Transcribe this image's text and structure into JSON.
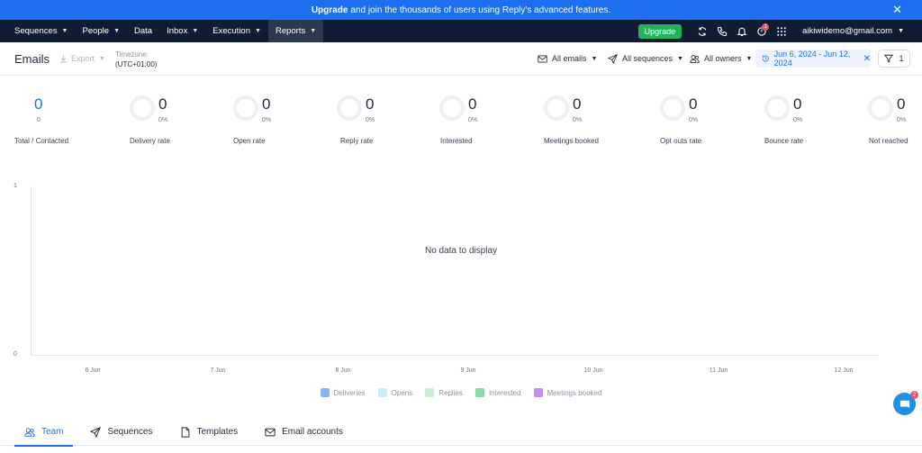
{
  "banner": {
    "strong": "Upgrade",
    "text": "and join the thousands of users using Reply's advanced features.",
    "close_glyph": "✕"
  },
  "nav": {
    "items": [
      {
        "label": "Sequences",
        "has_chevron": true
      },
      {
        "label": "People",
        "has_chevron": true
      },
      {
        "label": "Data",
        "has_chevron": false
      },
      {
        "label": "Inbox",
        "has_chevron": true
      },
      {
        "label": "Execution",
        "has_chevron": true
      },
      {
        "label": "Reports",
        "has_chevron": true,
        "active": true
      }
    ],
    "upgrade_label": "Upgrade",
    "notification_count": "1",
    "user_email": "aikiwidemo@gmail.com",
    "icons": [
      "sync-icon",
      "phone-icon",
      "bell-icon",
      "notification-icon",
      "apps-grid-icon"
    ]
  },
  "toolbar": {
    "title": "Emails",
    "export_label": "Export",
    "timezone_label": "Timezone:",
    "timezone_value": "(UTC+01:00)",
    "filters": {
      "emails": "All emails",
      "sequences": "All sequences",
      "owners": "All owners"
    },
    "date_range": "Jun 6, 2024 - Jun 12, 2024",
    "filter_count": "1"
  },
  "stats": [
    {
      "label": "Total / Contacted",
      "value": "0",
      "sub": "0",
      "ring": false
    },
    {
      "label": "Delivery rate",
      "value": "0",
      "sub": "0%",
      "ring": true
    },
    {
      "label": "Open rate",
      "value": "0",
      "sub": "0%",
      "ring": true
    },
    {
      "label": "Reply rate",
      "value": "0",
      "sub": "0%",
      "ring": true
    },
    {
      "label": "Interested",
      "value": "0",
      "sub": "0%",
      "ring": true
    },
    {
      "label": "Meetings booked",
      "value": "0",
      "sub": "0%",
      "ring": true
    },
    {
      "label": "Opt outs rate",
      "value": "0",
      "sub": "0%",
      "ring": true
    },
    {
      "label": "Bounce rate",
      "value": "0",
      "sub": "0%",
      "ring": true
    },
    {
      "label": "Not reached",
      "value": "0",
      "sub": "0%",
      "ring": true
    }
  ],
  "chart": {
    "empty_message": "No data to display",
    "y_ticks": [
      "1",
      "0"
    ],
    "x_ticks": [
      "6 Jun",
      "7 Jun",
      "8 Jun",
      "9 Jun",
      "10 Jun",
      "11 Jun",
      "12 Jun"
    ],
    "legend": [
      {
        "label": "Deliveries",
        "color": "#8ab4f5"
      },
      {
        "label": "Opens",
        "color": "#c9ecf7"
      },
      {
        "label": "Replies",
        "color": "#c8ecd6"
      },
      {
        "label": "Interested",
        "color": "#86dcab"
      },
      {
        "label": "Meetings booked",
        "color": "#c68cf0"
      }
    ]
  },
  "chart_data": {
    "type": "bar",
    "categories": [
      "6 Jun",
      "7 Jun",
      "8 Jun",
      "9 Jun",
      "10 Jun",
      "11 Jun",
      "12 Jun"
    ],
    "series": [
      {
        "name": "Deliveries",
        "values": []
      },
      {
        "name": "Opens",
        "values": []
      },
      {
        "name": "Replies",
        "values": []
      },
      {
        "name": "Interested",
        "values": []
      },
      {
        "name": "Meetings booked",
        "values": []
      }
    ],
    "ylim": [
      0,
      1
    ],
    "grid": false,
    "legend_position": "bottom"
  },
  "tabs": [
    {
      "label": "Team",
      "icon": "team-icon",
      "active": true
    },
    {
      "label": "Sequences",
      "icon": "send-icon",
      "active": false
    },
    {
      "label": "Templates",
      "icon": "document-icon",
      "active": false
    },
    {
      "label": "Email accounts",
      "icon": "mail-icon",
      "active": false
    }
  ],
  "chat": {
    "badge": "2"
  },
  "colors": {
    "accent": "#1e6ff0",
    "nav_bg": "#0f1c33",
    "upgrade_green": "#20b35a",
    "badge_red": "#e9546b"
  }
}
